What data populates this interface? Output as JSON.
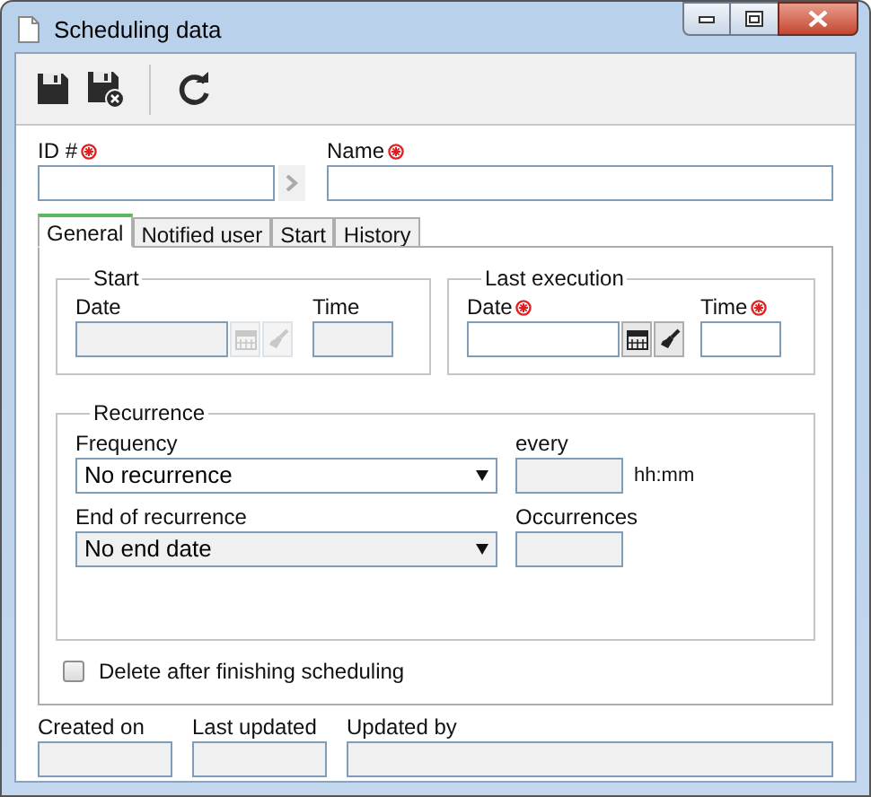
{
  "window": {
    "title": "Scheduling data"
  },
  "toolbar": [
    {
      "kind": "save"
    },
    {
      "kind": "save_close"
    },
    {
      "kind": "refresh"
    }
  ],
  "id_field": {
    "label": "ID #",
    "required": true,
    "disabled": false
  },
  "name_field": {
    "label": "Name",
    "required": true,
    "disabled": false
  },
  "tabs": [
    {
      "label": "General",
      "selected": true
    },
    {
      "label": "Notified user",
      "selected": false
    },
    {
      "label": "Start",
      "selected": false
    },
    {
      "label": "History",
      "selected": false
    }
  ],
  "start": {
    "title": "Start",
    "date": {
      "label": "Date",
      "required": false,
      "disabled": true
    },
    "time": {
      "label": "Time",
      "required": false,
      "disabled": true
    }
  },
  "last_execution": {
    "title": "Last execution",
    "date": {
      "label": "Date",
      "required": true,
      "disabled": false
    },
    "time": {
      "label": "Time",
      "required": true,
      "disabled": false
    }
  },
  "recurrence": {
    "title": "Recurrence",
    "frequency": {
      "label": "Frequency",
      "value": "No recurrence",
      "disabled": false
    },
    "every": {
      "label": "every",
      "unit": "hh:mm",
      "disabled": true
    },
    "end": {
      "label": "End of recurrence",
      "value": "No end date",
      "disabled": true
    },
    "occurrences": {
      "label": "Occurrences",
      "disabled": true
    }
  },
  "delete_after": {
    "label": "Delete after finishing scheduling",
    "checked": false
  },
  "footer": [
    {
      "label": "Created on",
      "disabled": true
    },
    {
      "label": "Last updated",
      "disabled": true
    },
    {
      "label": "Updated by",
      "disabled": true
    }
  ]
}
